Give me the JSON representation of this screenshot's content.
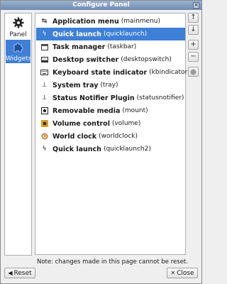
{
  "window": {
    "title": "Configure Panel"
  },
  "sidebar": {
    "items": [
      {
        "label": "Panel",
        "icon": "gear-icon"
      },
      {
        "label": "Widgets",
        "icon": "puzzle-icon",
        "selected": true
      }
    ]
  },
  "widgets": [
    {
      "name": "Application menu",
      "id": "(mainmenu)",
      "icon": "app-menu-icon"
    },
    {
      "name": "Quick launch",
      "id": "(quicklaunch)",
      "icon": "lightning-icon",
      "selected": true
    },
    {
      "name": "Task manager",
      "id": "(taskbar)",
      "icon": "taskbar-icon"
    },
    {
      "name": "Desktop switcher",
      "id": "(desktopswitch)",
      "icon": "desktop-switch-icon"
    },
    {
      "name": "Keyboard state indicator",
      "id": "(kbindicator)",
      "icon": "keyboard-icon"
    },
    {
      "name": "System tray",
      "id": "(tray)",
      "icon": "tray-icon"
    },
    {
      "name": "Status Notifier Plugin",
      "id": "(statusnotifier)",
      "icon": "notifier-icon"
    },
    {
      "name": "Removable media",
      "id": "(mount)",
      "icon": "media-icon"
    },
    {
      "name": "Volume control",
      "id": "(volume)",
      "icon": "volume-icon"
    },
    {
      "name": "World clock",
      "id": "(worldclock)",
      "icon": "clock-icon"
    },
    {
      "name": "Quick launch",
      "id": "(quicklaunch2)",
      "icon": "lightning-icon"
    }
  ],
  "note": "Note: changes made in this page cannot be reset.",
  "buttons": {
    "reset": "Reset",
    "close": "Close"
  },
  "colors": {
    "selection": "#3e7fd8",
    "titlebar": "#7f9bc2"
  }
}
